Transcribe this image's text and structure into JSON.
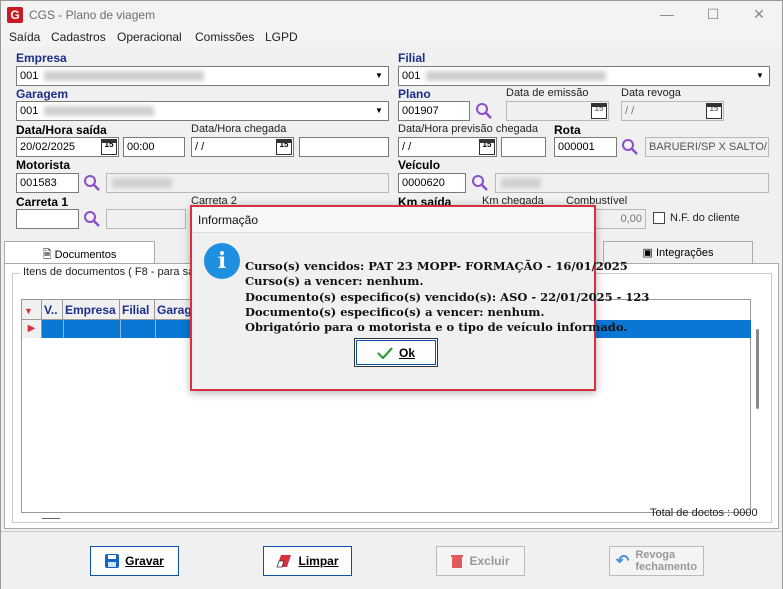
{
  "window": {
    "title": "CGS - Plano de viagem",
    "logo": "G"
  },
  "menu": [
    "Saída",
    "Cadastros",
    "Operacional",
    "Comissões",
    "LGPD"
  ],
  "fields": {
    "empresa": {
      "label": "Empresa",
      "value": "001"
    },
    "filial": {
      "label": "Filial",
      "value": "001"
    },
    "garagem": {
      "label": "Garagem",
      "value": "001"
    },
    "plano": {
      "label": "Plano",
      "value": "001907"
    },
    "data_emissao": {
      "label": "Data de emissão",
      "value": ""
    },
    "data_revoga": {
      "label": "Data revoga",
      "value": "/ /"
    },
    "data_hora_saida": {
      "label": "Data/Hora saída",
      "date": "20/02/2025",
      "time": "00:00"
    },
    "data_hora_chegada": {
      "label": "Data/Hora chegada",
      "date": "/ /",
      "time": ""
    },
    "data_hora_prev_chegada": {
      "label": "Data/Hora previsão chegada",
      "date": "/ /",
      "time": ""
    },
    "rota": {
      "label": "Rota",
      "value": "000001",
      "desc": "BARUERI/SP X SALTO/"
    },
    "motorista": {
      "label": "Motorista",
      "value": "001583"
    },
    "veiculo": {
      "label": "Veículo",
      "value": "0000620"
    },
    "carreta1": {
      "label": "Carreta 1",
      "value": ""
    },
    "carreta2": {
      "label": "Carreta 2"
    },
    "km_saida": {
      "label": "Km saída"
    },
    "km_chegada": {
      "label": "Km chegada"
    },
    "combustivel": {
      "label": "Combustível",
      "value": "0,00"
    },
    "nf_cliente": {
      "label": "N.F. do cliente"
    }
  },
  "tabs": {
    "documentos": "Documentos",
    "integracoes": "Integrações"
  },
  "grid": {
    "group_title": "Itens de documentos ( F8 - para sa",
    "columns": [
      "V..",
      "Empresa",
      "Filial",
      "Garage"
    ],
    "total": "Total de doctos : 0000"
  },
  "buttons": {
    "gravar": "Gravar",
    "limpar": "Limpar",
    "excluir": "Excluir",
    "revoga_1": "Revoga",
    "revoga_2": "fechamento"
  },
  "dialog": {
    "title": "Informação",
    "lines": [
      "Curso(s) vencidos: PAT 23 MOPP- FORMAÇÃO - 16/01/2025",
      "Curso(s) a vencer:  nenhum.",
      "Documento(s) especifico(s) vencido(s): ASO  - 22/01/2025 - 123",
      "Documento(s) especifico(s) a vencer:  nenhum.",
      "Obrigatório para o motorista e o tipo de veículo informado."
    ],
    "ok": "Ok"
  },
  "colors": {
    "accent": "#0a77d5",
    "label_blue": "#1b2f8a",
    "dialog_border": "#d7303f",
    "info_icon": "#1f8fe0"
  }
}
